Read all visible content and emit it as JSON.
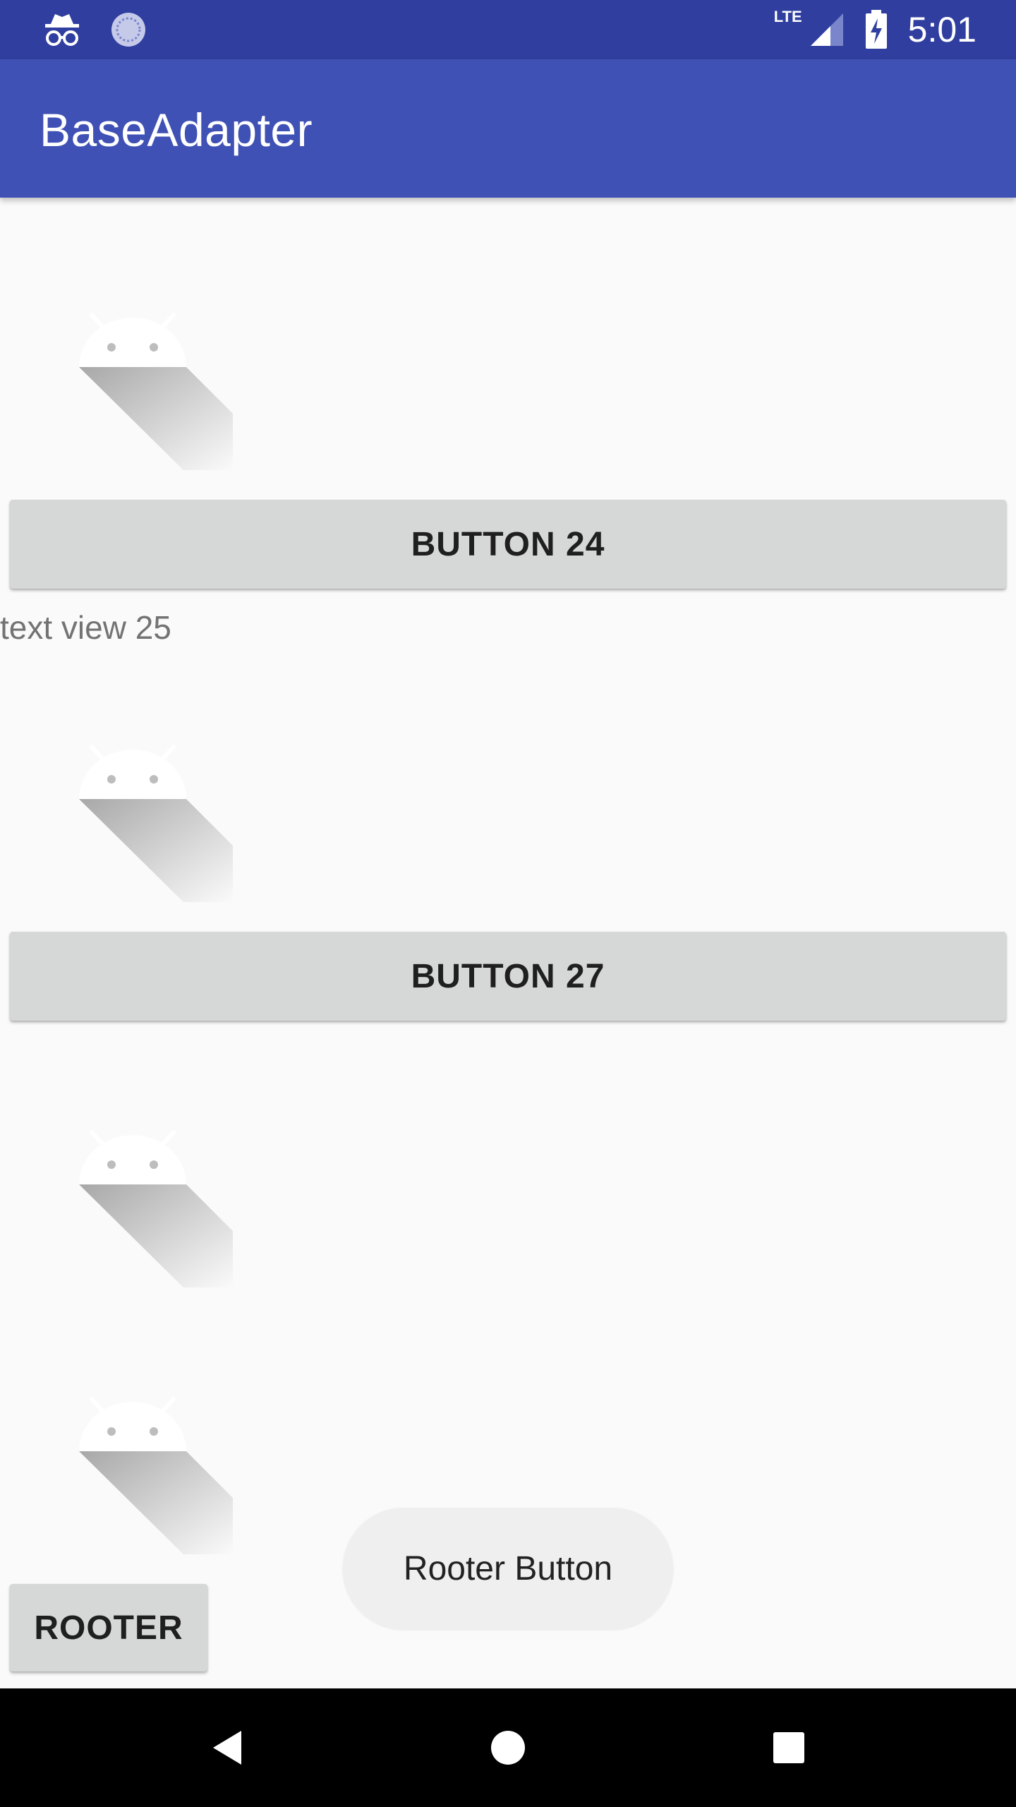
{
  "status_bar": {
    "time": "5:01",
    "network": "LTE",
    "icons": [
      "incognito-icon",
      "sync-icon",
      "signal-icon",
      "battery-charging-icon"
    ]
  },
  "app_bar": {
    "title": "BaseAdapter"
  },
  "list": {
    "button_24_label": "BUTTON 24",
    "text_view_25": "text view 25",
    "button_27_label": "BUTTON 27"
  },
  "rooter_button_label": "ROOTER",
  "toast": {
    "text": "Rooter Button"
  },
  "nav_bar": {
    "icons": [
      "back-icon",
      "home-icon",
      "recents-icon"
    ]
  }
}
